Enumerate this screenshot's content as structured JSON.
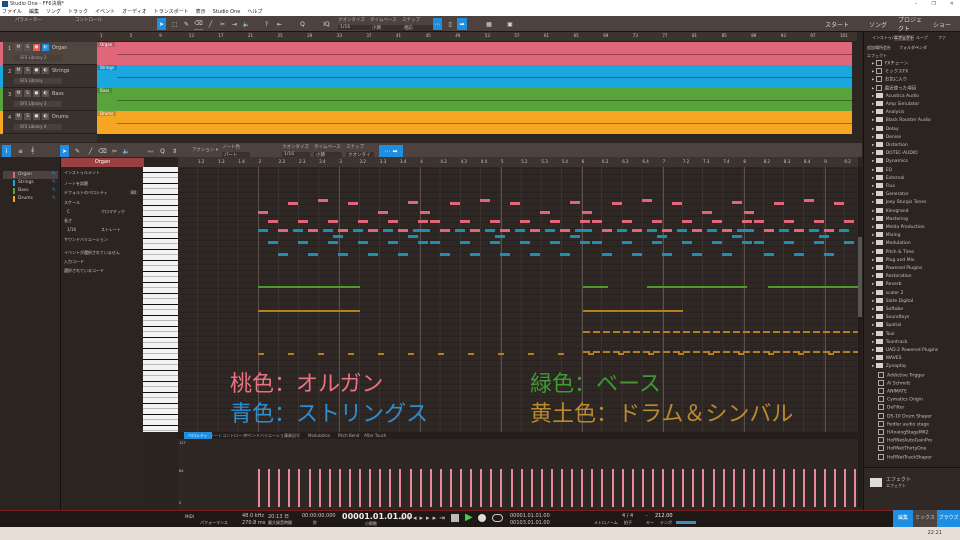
{
  "window": {
    "title": "Studio One - FF6決戦*",
    "controls": [
      "–",
      "❐",
      "✕"
    ]
  },
  "menu": [
    "ファイル",
    "編集",
    "ソング",
    "トラック",
    "イベント",
    "オーディオ",
    "トランスポート",
    "表示",
    "Studio One",
    "ヘルプ"
  ],
  "toolbar": {
    "param_label": "パラメーター",
    "control_label": "コントロール",
    "quantize_label": "クオンタイズ",
    "quantize_value": "1/16",
    "timebase_label": "タイムベース",
    "timebase_value": "小節",
    "snap_label": "スナップ",
    "snap_value": "相応",
    "iq": "IQ",
    "start": "スタート",
    "song": "ソング",
    "project": "プロジェクト",
    "show": "ショー"
  },
  "tracks": [
    {
      "num": "1",
      "name": "Organ",
      "inst": "SFS Library 2",
      "color": "#e0677a"
    },
    {
      "num": "2",
      "name": "Strings",
      "inst": "SFS Library",
      "color": "#1aa7df"
    },
    {
      "num": "3",
      "name": "Bass",
      "inst": "SFS Library 3",
      "color": "#58a43a"
    },
    {
      "num": "4",
      "name": "Drums",
      "inst": "SFS Library 4",
      "color": "#f5a623"
    }
  ],
  "ruler": [
    "1",
    "5",
    "9",
    "13",
    "17",
    "21",
    "25",
    "29",
    "33",
    "37",
    "41",
    "45",
    "49",
    "53",
    "57",
    "61",
    "65",
    "69",
    "73",
    "77",
    "81",
    "85",
    "89",
    "93",
    "97",
    "101"
  ],
  "browser": {
    "tabs": [
      "インストゥルメント",
      "エフェクト",
      "ループ",
      "ファ"
    ],
    "subtabs": [
      "追加場所",
      "会社",
      "フォルダー",
      "ベンダ"
    ],
    "crumb": "エフェクト",
    "special": [
      "FXチェーン",
      "ミックスFX",
      "お気に入り",
      "最近使った項目"
    ],
    "folders": [
      "Acustica Audio",
      "Amp Simulator",
      "Analysis",
      "Black Rooster Audio",
      "Delay",
      "Denise",
      "Distortion",
      "DOTEC-AUDIO",
      "Dynamics",
      "EQ",
      "External",
      "Flux",
      "Generator",
      "Joey Sturgis Tones",
      "Klevgrand",
      "Mastering",
      "Melda Production",
      "Mixing",
      "Modulation",
      "Pitch & Time",
      "Plug and Mix",
      "Powered Plugins",
      "Restoration",
      "Reverb",
      "scaler 2",
      "Slate Digital",
      "Softube",
      "Soundtoys",
      "Spatial",
      "Tool",
      "Toontrack",
      "UAD-2 Powered Plugins",
      "WAVES",
      "Zynaptiq"
    ],
    "plugins": [
      "Addictive Trigger",
      "Al Schmitt",
      "ANIMATE",
      "Cymatics Origin",
      "DeFilter",
      "DS-10 Drum Shaper",
      "fiedler audio stage",
      "HAnalogStageMK2",
      "HoRNetAutoGainPro",
      "HoRNetThirtyOne",
      "HoRNetTrackShaper"
    ],
    "footer_title": "エフェクト",
    "footer_sub": "エフェクト"
  },
  "editor": {
    "clip": "Organ",
    "action": "アクション",
    "notecolor_label": "ノート色",
    "notecolor_value": "パート",
    "quantize_label": "クオンタイズ",
    "quantize_value": "1/16",
    "timebase_label": "タイムベース",
    "timebase_value": "小節",
    "snap_label": "スナップ",
    "snap_value": "クオンタイズ",
    "ruler": [
      "1.2",
      "1.3",
      "1.4",
      "2",
      "2.2",
      "2.3",
      "2.4",
      "3",
      "3.2",
      "3.3",
      "3.4",
      "4",
      "4.2",
      "4.3",
      "4.4",
      "5",
      "5.2",
      "5.3",
      "5.4",
      "6",
      "6.2",
      "6.3",
      "6.4",
      "7",
      "7.2",
      "7.3",
      "7.4",
      "8",
      "8.2",
      "8.3",
      "8.4",
      "9",
      "9.2"
    ],
    "tracks": [
      "Organ",
      "Strings",
      "Bass",
      "Drums"
    ],
    "inspector": {
      "instrument": "インストゥルメント",
      "audition": "ノートを試聴",
      "velocity_label": "デフォルトのベロシティ",
      "velocity": "80",
      "scale": "スケール",
      "key": "C",
      "scale_type": "クロマチック",
      "length": "長さ",
      "len_value": "1/16",
      "len_type": "ストレート",
      "sound_var": "サウンドバリエーション",
      "no_event": "イベントが選択されていません",
      "input_chord": "入力コード",
      "selected_chord": "選択されているコード"
    },
    "lane_tabs": [
      "ベロシティ",
      "ノートコントローラー",
      "サウンドバリエーション",
      "演奏記号",
      "Modulation",
      "Pitch Bend",
      "After Touch"
    ],
    "vel_ticks": [
      "127",
      "64",
      "0"
    ]
  },
  "legend": [
    {
      "text": "桃色：オルガン",
      "color": "#e8727f"
    },
    {
      "text": "青色：ストリングス",
      "color": "#2d8fd0"
    },
    {
      "text": "緑色：ベース",
      "color": "#3f9a32"
    },
    {
      "text": "黄土色：ドラム＆シンバル",
      "color": "#b98a2e"
    }
  ],
  "transport": {
    "midi": "MIDI",
    "perf": "パフォーマンス",
    "rate": "48.0 kHz",
    "latency": "270.8 ms",
    "time_rec": "20:13 日",
    "time_rec_label": "最大録音時間",
    "time": "00:00:00.000",
    "time_label": "秒",
    "position": "00001.01.01.00",
    "pos_label": "小節数",
    "left": "00001.01.01.00",
    "right": "00103.01.01.00",
    "sig": "4 / 4",
    "sig_label": "拍子",
    "key": "-",
    "key_label": "キー",
    "tempo": "212.00",
    "tempo_label": "テンポ",
    "metronome": "メトロノーム"
  },
  "views": [
    "編集",
    "ミックス",
    "ブラウズ"
  ],
  "taskbar": {
    "clock": "22:21"
  }
}
